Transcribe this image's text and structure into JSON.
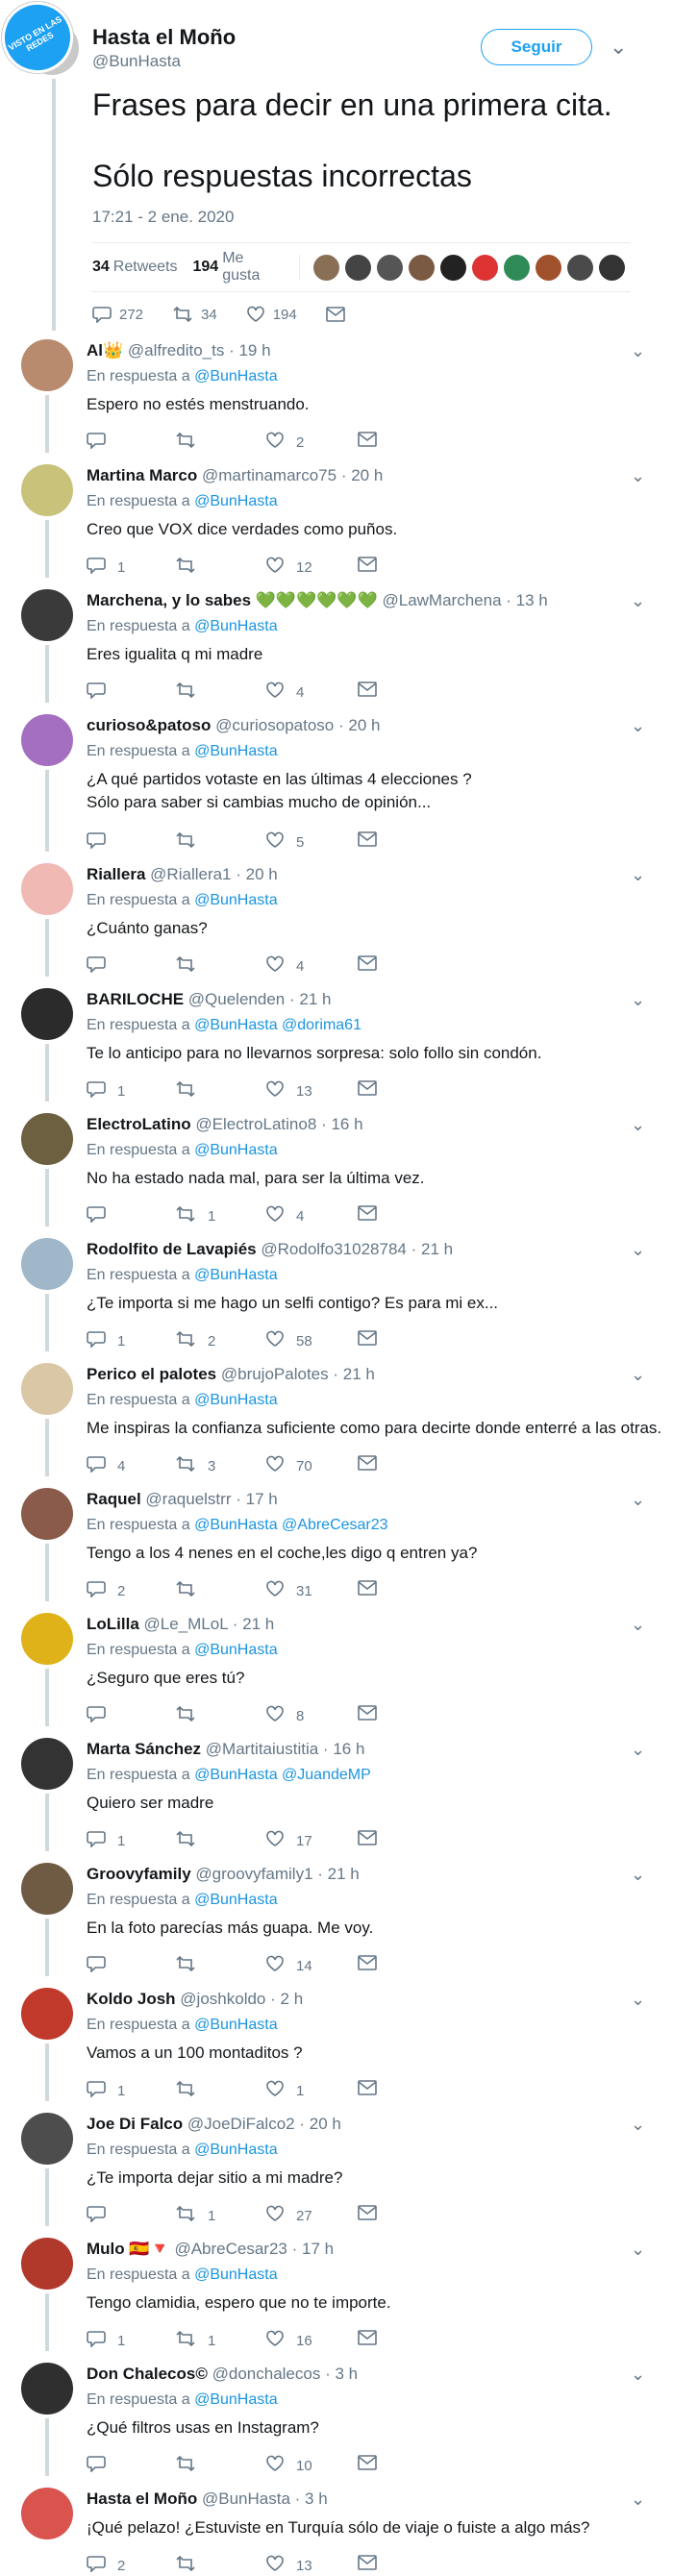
{
  "watermark": "VISTO EN LAS REDES",
  "main": {
    "name": "Hasta el Moño",
    "handle": "@BunHasta",
    "follow": "Seguir",
    "line1": "Frases para decir en una primera cita.",
    "line2": "Sólo respuestas incorrectas",
    "date": "17:21 - 2 ene. 2020",
    "retweets": "34",
    "retweets_label": "Retweets",
    "likes": "194",
    "likes_label": "Me gusta",
    "reply_count": "272",
    "rt_count": "34",
    "like_count": "194",
    "liker_colors": [
      "#8a6f57",
      "#444",
      "#555",
      "#7b5a44",
      "#222",
      "#d33",
      "#2e8b57",
      "#a0522d",
      "#4a4a4a",
      "#333"
    ]
  },
  "in_reply_label": "En respuesta a",
  "replies": [
    {
      "name": "Al👑",
      "handle": "@alfredito_ts",
      "time": "19 h",
      "to": "@BunHasta",
      "text": [
        "Espero no estés menstruando."
      ],
      "r": "",
      "rt": "",
      "l": "2",
      "color": "#b98b6e"
    },
    {
      "name": "Martina Marco",
      "handle": "@martinamarco75",
      "time": "20 h",
      "to": "@BunHasta",
      "text": [
        "Creo que VOX dice verdades como puños."
      ],
      "r": "1",
      "rt": "",
      "l": "12",
      "color": "#c8c27a"
    },
    {
      "name": "Marchena, y lo sabes 💚💚💚💚💚💚",
      "handle": "@LawMarchena",
      "time": "13 h",
      "to": "@BunHasta",
      "text": [
        "Eres igualita q mi madre"
      ],
      "r": "",
      "rt": "",
      "l": "4",
      "color": "#3a3a3a"
    },
    {
      "name": "curioso&patoso",
      "handle": "@curiosopatoso",
      "time": "20 h",
      "to": "@BunHasta",
      "text": [
        "¿A qué partidos votaste en las últimas 4 elecciones ?",
        "Sólo para saber si cambias mucho de opinión..."
      ],
      "r": "",
      "rt": "",
      "l": "5",
      "color": "#a46fc0"
    },
    {
      "name": "Riallera",
      "handle": "@Riallera1",
      "time": "20 h",
      "to": "@BunHasta",
      "text": [
        "¿Cuánto ganas?"
      ],
      "r": "",
      "rt": "",
      "l": "4",
      "color": "#f1b9b4"
    },
    {
      "name": "BARILOCHE",
      "handle": "@Quelenden",
      "time": "21 h",
      "to": "@BunHasta @dorima61",
      "text": [
        "Te lo anticipo para no llevarnos sorpresa: solo follo sin condón."
      ],
      "r": "1",
      "rt": "",
      "l": "13",
      "color": "#2b2b2b"
    },
    {
      "name": "ElectroLatino",
      "handle": "@ElectroLatino8",
      "time": "16 h",
      "to": "@BunHasta",
      "text": [
        "No ha estado nada mal, para ser la última vez."
      ],
      "r": "",
      "rt": "1",
      "l": "4",
      "color": "#6c6040"
    },
    {
      "name": "Rodolfito de Lavapiés",
      "handle": "@Rodolfo31028784",
      "time": "21 h",
      "to": "@BunHasta",
      "text": [
        "¿Te importa si me hago un selfi contigo? Es para mi ex..."
      ],
      "r": "1",
      "rt": "2",
      "l": "58",
      "color": "#9fb7c9"
    },
    {
      "name": "Perico el palotes",
      "handle": "@brujoPalotes",
      "time": "21 h",
      "to": "@BunHasta",
      "text": [
        "Me inspiras la confianza suficiente como para decirte donde enterré a las otras."
      ],
      "r": "4",
      "rt": "3",
      "l": "70",
      "color": "#d9c7a6"
    },
    {
      "name": "Raquel",
      "handle": "@raquelstrr",
      "time": "17 h",
      "to": "@BunHasta @AbreCesar23",
      "text": [
        "Tengo a los 4 nenes en el coche,les digo q entren ya?"
      ],
      "r": "2",
      "rt": "",
      "l": "31",
      "color": "#8a5a4a"
    },
    {
      "name": "LoLilla",
      "handle": "@Le_MLoL",
      "time": "21 h",
      "to": "@BunHasta",
      "text": [
        "¿Seguro que eres tú?"
      ],
      "r": "",
      "rt": "",
      "l": "8",
      "color": "#e0b21a"
    },
    {
      "name": "Marta Sánchez",
      "handle": "@Martitaiustitia",
      "time": "16 h",
      "to": "@BunHasta @JuandeMP",
      "text": [
        "Quiero ser madre"
      ],
      "r": "1",
      "rt": "",
      "l": "17",
      "color": "#333333"
    },
    {
      "name": "Groovyfamily",
      "handle": "@groovyfamily1",
      "time": "21 h",
      "to": "@BunHasta",
      "text": [
        "En la foto parecías más guapa. Me voy."
      ],
      "r": "",
      "rt": "",
      "l": "14",
      "color": "#6f5a44"
    },
    {
      "name": "Koldo Josh",
      "handle": "@joshkoldo",
      "time": "2 h",
      "to": "@BunHasta",
      "text": [
        "Vamos a un 100 montaditos ?"
      ],
      "r": "1",
      "rt": "",
      "l": "1",
      "color": "#c0392b"
    },
    {
      "name": "Joe Di Falco",
      "handle": "@JoeDiFalco2",
      "time": "20 h",
      "to": "@BunHasta",
      "text": [
        "¿Te importa dejar sitio a mi madre?"
      ],
      "r": "",
      "rt": "1",
      "l": "27",
      "color": "#4d4d4d"
    },
    {
      "name": "Mulo 🇪🇸🔻",
      "handle": "@AbreCesar23",
      "time": "17 h",
      "to": "@BunHasta",
      "text": [
        "Tengo clamidia, espero que no te importe."
      ],
      "r": "1",
      "rt": "1",
      "l": "16",
      "color": "#b0392b"
    },
    {
      "name": "Don Chalecos©",
      "handle": "@donchalecos",
      "time": "3 h",
      "to": "@BunHasta",
      "text": [
        "¿Qué filtros usas en Instagram?"
      ],
      "r": "",
      "rt": "",
      "l": "10",
      "color": "#2f2f2f"
    },
    {
      "name": "Hasta el Moño",
      "handle": "@BunHasta",
      "time": "3 h",
      "to": "",
      "text": [
        "¡Qué pelazo! ¿Estuviste en Turquía sólo de viaje o fuiste a algo más?"
      ],
      "r": "2",
      "rt": "",
      "l": "13",
      "color": "#d9534f"
    }
  ]
}
